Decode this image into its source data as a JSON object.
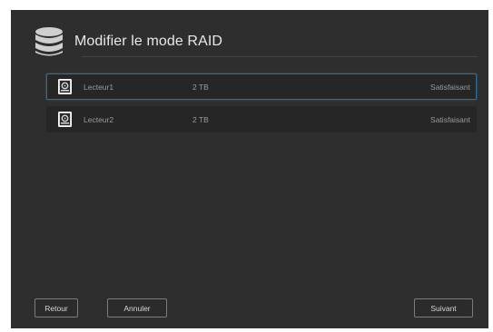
{
  "dialog": {
    "title": "Modifier le mode RAID",
    "title_icon": "database-icon"
  },
  "drives": [
    {
      "name": "Lecteur1",
      "size": "2 TB",
      "status": "Satisfaisant",
      "icon": "hard-drive-icon",
      "selected": true
    },
    {
      "name": "Lecteur2",
      "size": "2 TB",
      "status": "Satisfaisant",
      "icon": "hard-drive-icon",
      "selected": false
    }
  ],
  "buttons": {
    "back_label": "Retour",
    "cancel_label": "Annuler",
    "next_label": "Suivant"
  },
  "colors": {
    "background": "#2e2e2e",
    "row_background": "#262626",
    "selection_border": "#2f6f93",
    "text": "#9a9a9a"
  }
}
